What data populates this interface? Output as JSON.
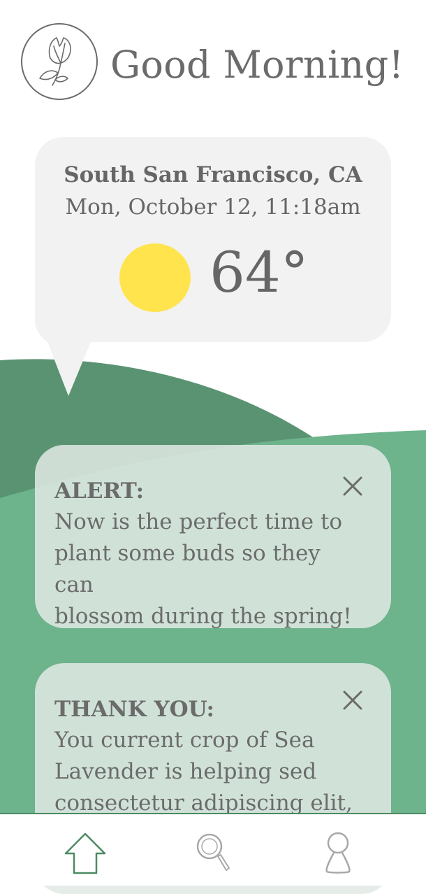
{
  "header": {
    "greeting": "Good Morning!",
    "logo_icon": "tulip-icon"
  },
  "weather": {
    "location": "South San Francisco, CA",
    "datetime": "Mon, October 12, 11:18am",
    "temperature": "64°",
    "condition_icon": "sun-icon"
  },
  "notifications": [
    {
      "title": "ALERT:",
      "lines": [
        "Now is the perfect time to",
        "plant some buds so they can",
        "blossom during the spring!"
      ],
      "close_icon": "close-icon"
    },
    {
      "title": "THANK YOU:",
      "lines": [
        "You current crop of Sea",
        "Lavender is helping sed",
        "consectetur adipiscing elit,"
      ],
      "close_icon": "close-icon"
    }
  ],
  "nav": {
    "items": [
      {
        "icon": "home-icon",
        "active": true
      },
      {
        "icon": "search-icon",
        "active": false
      },
      {
        "icon": "profile-icon",
        "active": false
      }
    ]
  },
  "colors": {
    "hill_dark": "#5a9371",
    "hill_light": "#6db38b",
    "sun": "#ffe44d",
    "text": "#6b6b6b",
    "active_nav": "#4c8a63",
    "inactive_nav": "#a8a8a8"
  }
}
